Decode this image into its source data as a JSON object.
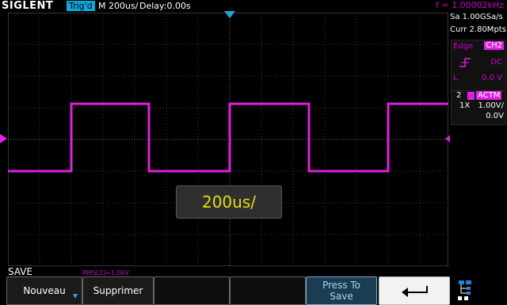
{
  "header": {
    "brand": "SIGLENT",
    "trigger_status": "Trig'd",
    "timebase": "M 200us/",
    "delay": "Delay:0.00s",
    "frequency": "f = 1.00002kHz"
  },
  "acquisition": {
    "sample_rate": "Sa 1.00GSa/s",
    "memory_depth": "Curr 2.80Mpts"
  },
  "trigger": {
    "type": "Edge",
    "source": "CH2",
    "coupling": "DC",
    "level_label": "L",
    "level": "0.0 V"
  },
  "channel": {
    "number": "2",
    "mode_badge": "ACTM",
    "probe": "1X",
    "scale": "1.00V/",
    "offset": "0.0V"
  },
  "overlay_text": "200us/",
  "menu": {
    "title": "SAVE",
    "measurement": "RMS[2]=1.06V",
    "buttons": {
      "new": "Nouveau",
      "delete": "Supprimer",
      "press_to_save_line1": "Press To",
      "press_to_save_line2": "Save"
    }
  },
  "colors": {
    "channel2": "#e020e0",
    "trigger_badge": "#0aa7d8",
    "overlay_text": "#e6dc14"
  },
  "icons": {
    "trigger_position": "triangle-down-icon",
    "ch2_level_marker": "triangle-right-icon",
    "trigger_level_marker": "triangle-left-icon",
    "back": "return-arrow-icon",
    "usb": "usb-tree-icon",
    "dropdown": "blue-down-arrow-icon"
  }
}
